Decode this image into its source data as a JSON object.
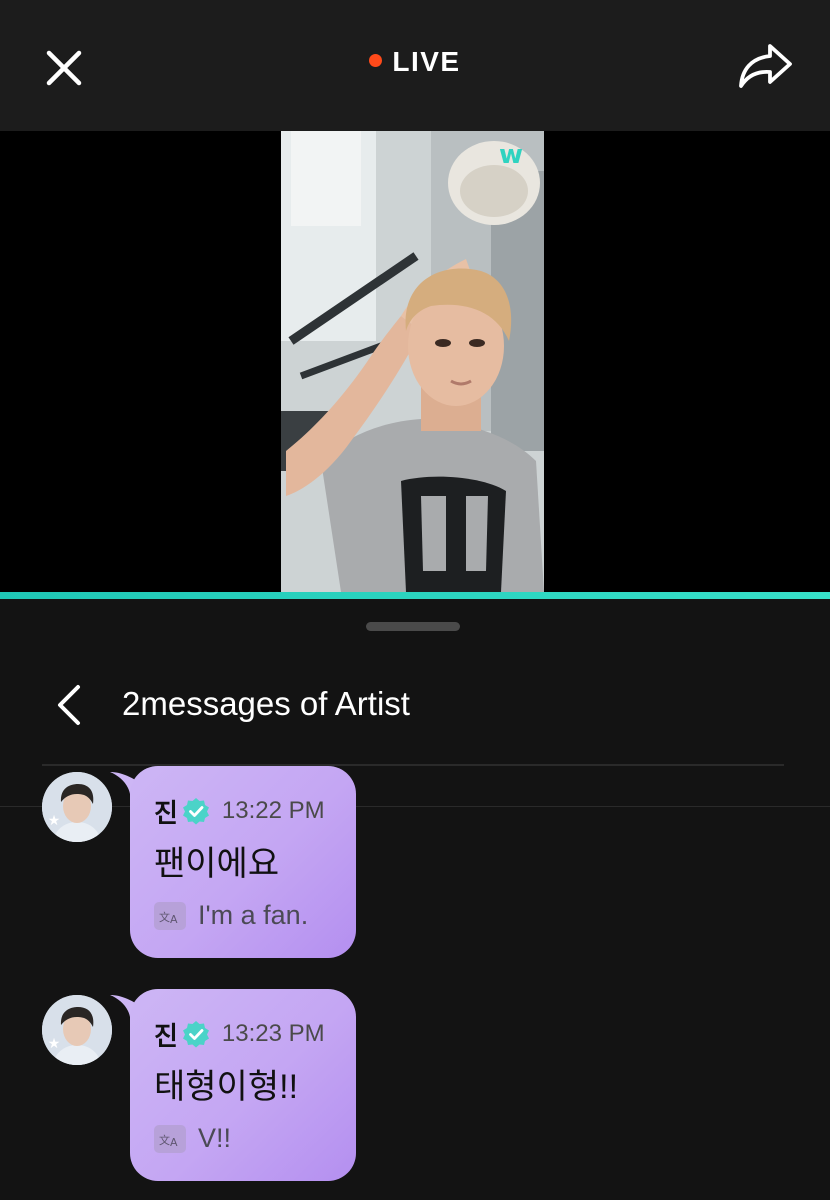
{
  "header": {
    "live_label": "LIVE",
    "live_dot_color": "#ff4a1a",
    "close_icon": "close-icon",
    "share_icon": "share-arrow-icon"
  },
  "video": {
    "watermark_icon": "weverse-logo-icon",
    "progress_color": "#1fc7b5"
  },
  "sheet": {
    "title": "2messages of Artist",
    "back_icon": "chevron-left-icon"
  },
  "messages": [
    {
      "sender": "진",
      "verified_icon": "verified-badge-icon",
      "time": "13:22 PM",
      "text": "팬이에요",
      "translation": "I'm a fan.",
      "translate_icon": "translate-icon"
    },
    {
      "sender": "진",
      "verified_icon": "verified-badge-icon",
      "time": "13:23 PM",
      "text": "태형이형!!",
      "translation": "V!!",
      "translate_icon": "translate-icon"
    }
  ],
  "colors": {
    "bubble": "#c4a6f3",
    "verified": "#4bd3c8",
    "background": "#131313"
  }
}
